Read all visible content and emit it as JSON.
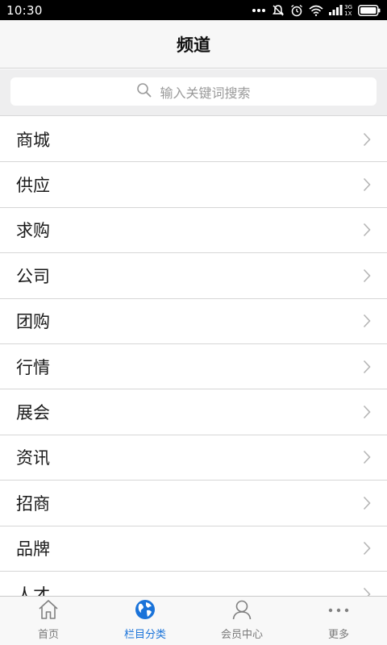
{
  "status_bar": {
    "time": "10:30",
    "network_label_top": "3G",
    "network_label_bottom": "1X",
    "icons": [
      "more-dots-icon",
      "mute-icon",
      "alarm-icon",
      "wifi-icon",
      "signal-icon",
      "battery-icon"
    ]
  },
  "header": {
    "title": "频道"
  },
  "search": {
    "placeholder": "输入关键词搜索",
    "icon": "search-icon"
  },
  "channels": [
    {
      "label": "商城"
    },
    {
      "label": "供应"
    },
    {
      "label": "求购"
    },
    {
      "label": "公司"
    },
    {
      "label": "团购"
    },
    {
      "label": "行情"
    },
    {
      "label": "展会"
    },
    {
      "label": "资讯"
    },
    {
      "label": "招商"
    },
    {
      "label": "品牌"
    },
    {
      "label": "人才"
    }
  ],
  "tabs": [
    {
      "label": "首页",
      "icon": "home-icon",
      "active": false
    },
    {
      "label": "栏目分类",
      "icon": "globe-icon",
      "active": true
    },
    {
      "label": "会员中心",
      "icon": "user-icon",
      "active": false
    },
    {
      "label": "更多",
      "icon": "more-icon",
      "active": false
    }
  ],
  "colors": {
    "accent": "#1a73d9",
    "inactive": "#7a7a7a"
  }
}
